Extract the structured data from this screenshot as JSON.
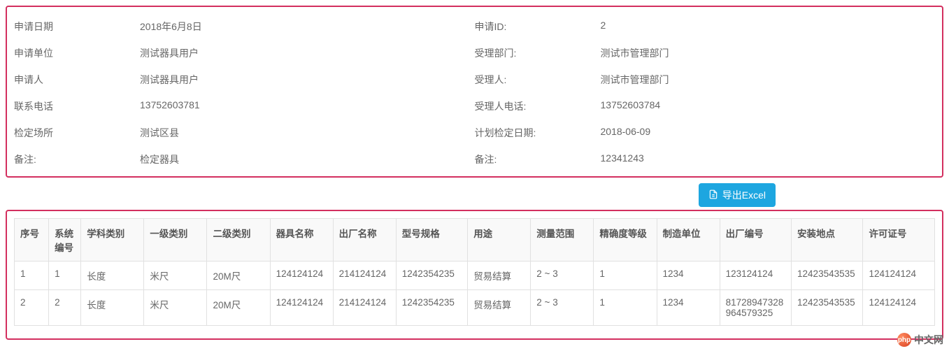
{
  "info": {
    "rows": [
      {
        "l1": "申请日期",
        "v1": "2018年6月8日",
        "l2": "申请ID:",
        "v2": "2"
      },
      {
        "l1": "申请单位",
        "v1": "测试器具用户",
        "l2": "受理部门:",
        "v2": "测试市管理部门"
      },
      {
        "l1": "申请人",
        "v1": "测试器具用户",
        "l2": "受理人:",
        "v2": "测试市管理部门"
      },
      {
        "l1": "联系电话",
        "v1": "13752603781",
        "l2": "受理人电话:",
        "v2": "13752603784"
      },
      {
        "l1": "检定场所",
        "v1": "测试区县",
        "l2": "计划检定日期:",
        "v2": "2018-06-09"
      },
      {
        "l1": "备注:",
        "v1": "检定器具",
        "l2": "备注:",
        "v2": "12341243"
      }
    ]
  },
  "toolbar": {
    "export_label": "导出Excel"
  },
  "table": {
    "headers": [
      "序号",
      "系统编号",
      "学科类别",
      "一级类别",
      "二级类别",
      "器具名称",
      "出厂名称",
      "型号规格",
      "用途",
      "测量范围",
      "精确度等级",
      "制造单位",
      "出厂编号",
      "安装地点",
      "许可证号"
    ],
    "rows": [
      [
        "1",
        "1",
        "长度",
        "米尺",
        "20M尺",
        "124124124",
        "214124124",
        "1242354235",
        "贸易结算",
        "2 ~ 3",
        "1",
        "1234",
        "123124124",
        "12423543535",
        "124124124"
      ],
      [
        "2",
        "2",
        "长度",
        "米尺",
        "20M尺",
        "124124124",
        "214124124",
        "1242354235",
        "贸易结算",
        "2 ~ 3",
        "1",
        "1234",
        "81728947328964579325",
        "12423543535",
        "124124124"
      ]
    ]
  },
  "watermark": {
    "logo_text": "php",
    "text": "中文网"
  }
}
